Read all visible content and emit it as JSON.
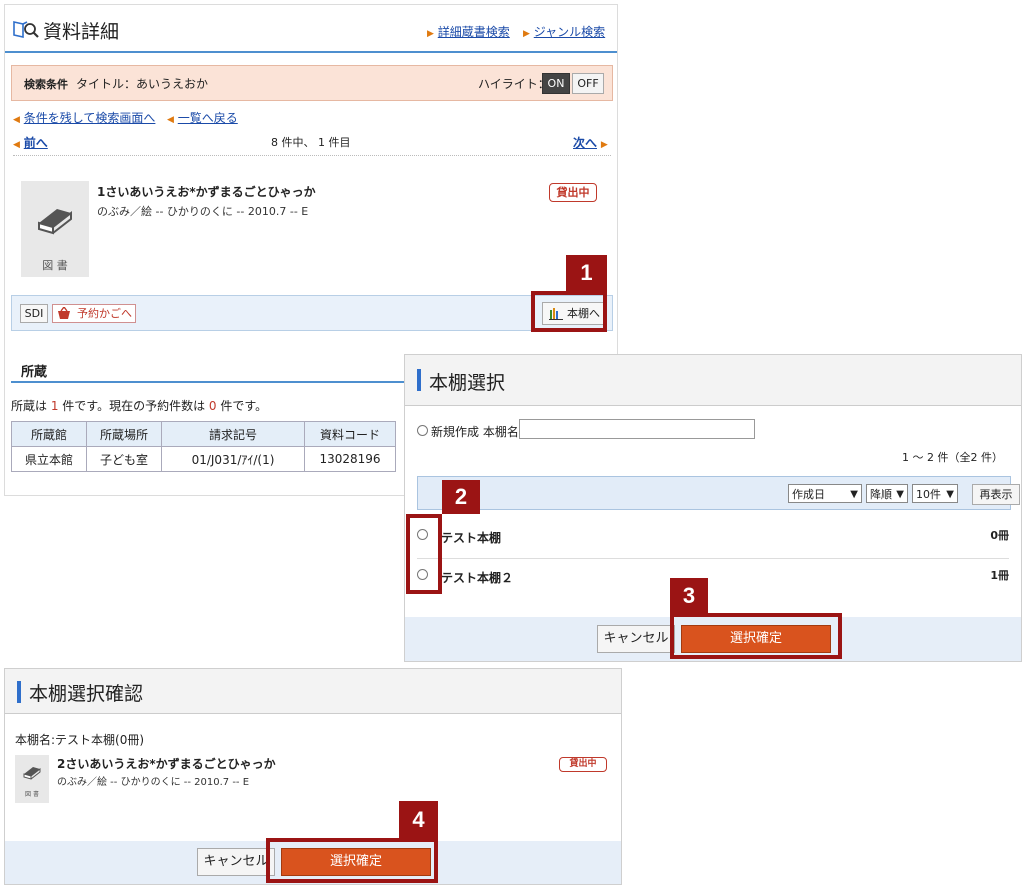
{
  "detail": {
    "title": "資料詳細",
    "links": {
      "advanced_search": "詳細蔵書検索",
      "genre_search": "ジャンル検索"
    },
    "condition": {
      "label": "検索条件",
      "value": "タイトル：あいうえおか",
      "highlight_label": "ハイライト：",
      "on": "ON",
      "off": "OFF",
      "selected": "ON"
    },
    "nav": {
      "back_to_search": "条件を残して検索画面へ",
      "back_to_list": "一覧へ戻る",
      "prev": "前へ",
      "position": "8 件中、 1 件目",
      "next": "次へ"
    },
    "item": {
      "thumb_label": "図 書",
      "title": "1さいあいうえお*かずまるごとひゃっか",
      "meta": "のぶみ／絵 -- ひかりのくに -- 2010.7 -- E",
      "status": "貸出中"
    },
    "actions": {
      "sdi": "SDI",
      "basket": "予約かごへ",
      "shelf": "本棚へ"
    },
    "holdings": {
      "heading": "所蔵",
      "summary_pre": "所蔵は ",
      "count": "1",
      "summary_mid": " 件です。現在の予約件数は ",
      "reserve_count": "0",
      "summary_post": " 件です。",
      "columns": [
        "所蔵館",
        "所蔵場所",
        "請求記号",
        "資料コード"
      ],
      "rows": [
        [
          "県立本館",
          "子ども室",
          "01/J031/ｱｲ/(1)",
          "13028196"
        ]
      ]
    }
  },
  "shelf_select": {
    "title": "本棚選択",
    "new_label": "新規作成 本棚名",
    "new_value": "",
    "count_text": "1 ～ 2 件（全2 件）",
    "sort": {
      "field": "作成日",
      "order": "降順",
      "per_page": "10件",
      "redisplay": "再表示"
    },
    "shelves": [
      {
        "name": "テスト本棚",
        "count": "0冊"
      },
      {
        "name": "テスト本棚２",
        "count": "1冊"
      }
    ],
    "cancel": "キャンセル",
    "confirm": "選択確定"
  },
  "confirm_dialog": {
    "title": "本棚選択確認",
    "shelf_label": "本棚名:テスト本棚(0冊)",
    "thumb_label": "図 書",
    "item_title": "2さいあいうえお*かずまるごとひゃっか",
    "item_meta": "のぶみ／絵 -- ひかりのくに -- 2010.7 -- E",
    "status": "貸出中",
    "cancel": "キャンセル",
    "confirm": "選択確定"
  },
  "callouts": [
    "1",
    "2",
    "3",
    "4"
  ],
  "colors": {
    "accent_blue": "#2f6fcb",
    "callout": "#9b1414",
    "confirm": "#d9531e",
    "status": "#c0392b"
  }
}
